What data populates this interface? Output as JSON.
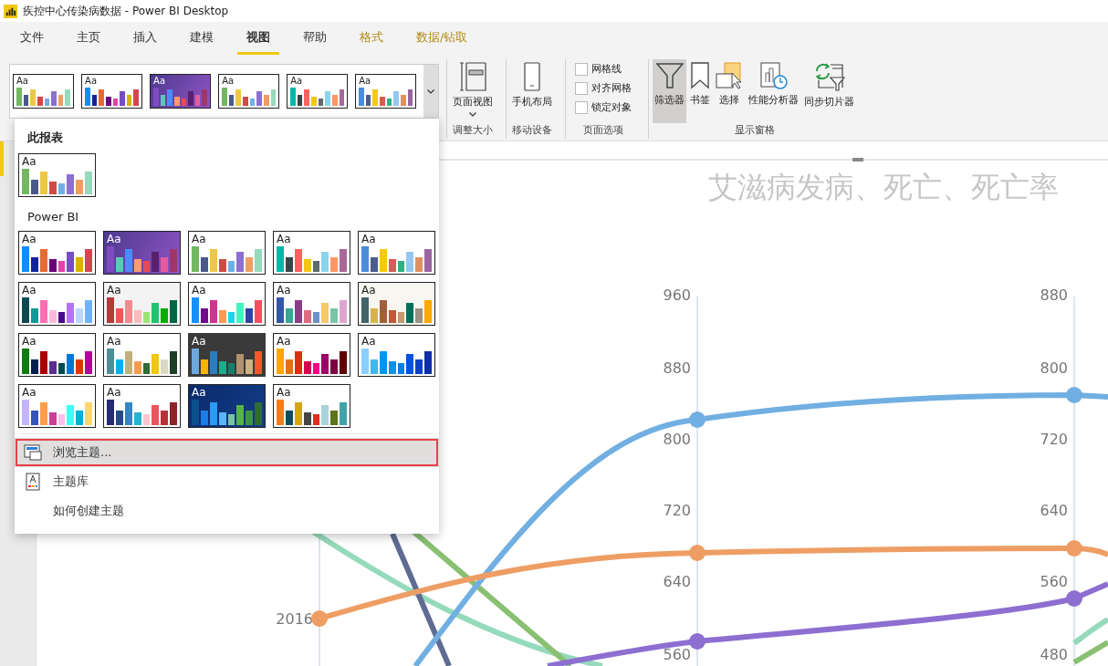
{
  "window": {
    "title": "疾控中心传染病数据 - Power BI Desktop"
  },
  "tabs": [
    {
      "label": "文件",
      "kind": "normal",
      "selected": false
    },
    {
      "label": "主页",
      "kind": "normal",
      "selected": false
    },
    {
      "label": "插入",
      "kind": "normal",
      "selected": false
    },
    {
      "label": "建模",
      "kind": "normal",
      "selected": false
    },
    {
      "label": "视图",
      "kind": "normal",
      "selected": true
    },
    {
      "label": "帮助",
      "kind": "normal",
      "selected": false
    },
    {
      "label": "格式",
      "kind": "contextual",
      "selected": false
    },
    {
      "label": "数据/钻取",
      "kind": "contextual",
      "selected": false
    }
  ],
  "ribbon": {
    "theme_gallery": [
      {
        "sample": "Aa",
        "kind": "light",
        "bars": [
          {
            "color": "#73b761"
          },
          {
            "color": "#4a588a"
          },
          {
            "color": "#ecc846"
          },
          {
            "color": "#cd4c46"
          },
          {
            "color": "#71afe2"
          },
          {
            "color": "#8d6fd1"
          },
          {
            "color": "#ee9e64"
          },
          {
            "color": "#95dabb"
          }
        ]
      },
      {
        "sample": "Aa",
        "kind": "light",
        "bars": [
          {
            "color": "#118dff"
          },
          {
            "color": "#12239e"
          },
          {
            "color": "#e66c37"
          },
          {
            "color": "#6b007b"
          },
          {
            "color": "#e044a7"
          },
          {
            "color": "#744ec2"
          },
          {
            "color": "#d9b300"
          },
          {
            "color": "#d64550"
          }
        ]
      },
      {
        "sample": "Aa",
        "kind": "purple",
        "bars": [
          {
            "color": "#7f4bc0"
          },
          {
            "color": "#5bc9b4"
          },
          {
            "color": "#4a8cff"
          },
          {
            "color": "#ff9a70"
          },
          {
            "color": "#e84a55"
          },
          {
            "color": "#5a2070"
          },
          {
            "color": "#e85a9c"
          },
          {
            "color": "#a0356a"
          }
        ]
      },
      {
        "sample": "Aa",
        "kind": "light",
        "bars": [
          {
            "color": "#73b761"
          },
          {
            "color": "#4a588a"
          },
          {
            "color": "#ecc846"
          },
          {
            "color": "#cd4c46"
          },
          {
            "color": "#71afe2"
          },
          {
            "color": "#8d6fd1"
          },
          {
            "color": "#ee9e64"
          },
          {
            "color": "#95dabb"
          }
        ]
      },
      {
        "sample": "Aa",
        "kind": "light",
        "bars": [
          {
            "color": "#01b8aa"
          },
          {
            "color": "#374649"
          },
          {
            "color": "#fd625e"
          },
          {
            "color": "#f2c80f"
          },
          {
            "color": "#5f6b6d"
          },
          {
            "color": "#8ad4eb"
          },
          {
            "color": "#fe9666"
          },
          {
            "color": "#a66999"
          }
        ]
      },
      {
        "sample": "Aa",
        "kind": "light",
        "bars": [
          {
            "color": "#4a8ddc"
          },
          {
            "color": "#4c5d8a"
          },
          {
            "color": "#f3c911"
          },
          {
            "color": "#dc5b57"
          },
          {
            "color": "#33ae81"
          },
          {
            "color": "#95c8f0"
          },
          {
            "color": "#dd915f"
          },
          {
            "color": "#9a64a0"
          }
        ]
      }
    ],
    "groups": [
      {
        "label": "调整大小",
        "kind": "buttons",
        "items": [
          {
            "label": "页面视图",
            "kind": "page-view",
            "caret": true,
            "selected": false
          }
        ]
      },
      {
        "label": "移动设备",
        "kind": "buttons",
        "items": [
          {
            "label": "手机布局",
            "kind": "phone",
            "caret": false,
            "selected": false
          }
        ]
      },
      {
        "label": "页面选项",
        "kind": "checkboxes",
        "items": [
          {
            "label": "网格线",
            "checked": false
          },
          {
            "label": "对齐网格",
            "checked": false
          },
          {
            "label": "锁定对象",
            "checked": false
          }
        ]
      },
      {
        "label": "显示窗格",
        "kind": "buttons",
        "items": [
          {
            "label": "筛选器",
            "kind": "filter",
            "caret": false,
            "selected": true
          },
          {
            "label": "书签",
            "kind": "bookmark",
            "caret": false,
            "selected": false
          },
          {
            "label": "选择",
            "kind": "selection",
            "caret": false,
            "selected": false
          },
          {
            "label": "性能分析器",
            "kind": "performance",
            "caret": false,
            "selected": false
          },
          {
            "label": "同步切片器",
            "kind": "sync",
            "caret": false,
            "selected": false
          }
        ]
      }
    ]
  },
  "theme_menu": {
    "sections": [
      {
        "heading": "此报表",
        "themes": [
          {
            "sample": "Aa",
            "kind": "light",
            "bars": [
              {
                "color": "#73b761"
              },
              {
                "color": "#4a588a"
              },
              {
                "color": "#ecc846"
              },
              {
                "color": "#cd4c46"
              },
              {
                "color": "#71afe2"
              },
              {
                "color": "#8d6fd1"
              },
              {
                "color": "#ee9e64"
              },
              {
                "color": "#95dabb"
              }
            ]
          }
        ]
      },
      {
        "heading": "Power BI",
        "themes": [
          {
            "sample": "Aa",
            "kind": "light",
            "bars": [
              {
                "color": "#118dff"
              },
              {
                "color": "#12239e"
              },
              {
                "color": "#e66c37"
              },
              {
                "color": "#6b007b"
              },
              {
                "color": "#e044a7"
              },
              {
                "color": "#744ec2"
              },
              {
                "color": "#d9b300"
              },
              {
                "color": "#d64550"
              }
            ]
          },
          {
            "sample": "Aa",
            "kind": "purple",
            "bars": [
              {
                "color": "#7f4bc0"
              },
              {
                "color": "#5bc9b4"
              },
              {
                "color": "#4a8cff"
              },
              {
                "color": "#ff9a70"
              },
              {
                "color": "#e84a55"
              },
              {
                "color": "#5a2070"
              },
              {
                "color": "#e85a9c"
              },
              {
                "color": "#a0356a"
              }
            ]
          },
          {
            "sample": "Aa",
            "kind": "light",
            "bars": [
              {
                "color": "#73b761"
              },
              {
                "color": "#4a588a"
              },
              {
                "color": "#ecc846"
              },
              {
                "color": "#cd4c46"
              },
              {
                "color": "#71afe2"
              },
              {
                "color": "#8d6fd1"
              },
              {
                "color": "#ee9e64"
              },
              {
                "color": "#95dabb"
              }
            ]
          },
          {
            "sample": "Aa",
            "kind": "light",
            "bars": [
              {
                "color": "#01b8aa"
              },
              {
                "color": "#374649"
              },
              {
                "color": "#fd625e"
              },
              {
                "color": "#f2c80f"
              },
              {
                "color": "#5f6b6d"
              },
              {
                "color": "#8ad4eb"
              },
              {
                "color": "#fe9666"
              },
              {
                "color": "#a66999"
              }
            ]
          },
          {
            "sample": "Aa",
            "kind": "light",
            "bars": [
              {
                "color": "#4a8ddc"
              },
              {
                "color": "#4c5d8a"
              },
              {
                "color": "#f3c911"
              },
              {
                "color": "#dc5b57"
              },
              {
                "color": "#33ae81"
              },
              {
                "color": "#95c8f0"
              },
              {
                "color": "#dd915f"
              },
              {
                "color": "#9a64a0"
              }
            ]
          },
          {
            "sample": "Aa",
            "kind": "light",
            "bars": [
              {
                "color": "#0b4a52"
              },
              {
                "color": "#119a9a"
              },
              {
                "color": "#ff6fb4"
              },
              {
                "color": "#ffb8dc"
              },
              {
                "color": "#4b0a8e"
              },
              {
                "color": "#b672ff"
              },
              {
                "color": "#b8d8ff"
              },
              {
                "color": "#6fb2ff"
              }
            ]
          },
          {
            "sample": "Aa",
            "kind": "gray",
            "bars": [
              {
                "color": "#b73a3a"
              },
              {
                "color": "#ec5656"
              },
              {
                "color": "#f28a90"
              },
              {
                "color": "#f8bcbd"
              },
              {
                "color": "#99e472"
              },
              {
                "color": "#23c26f"
              },
              {
                "color": "#0aac00"
              },
              {
                "color": "#026645"
              }
            ]
          },
          {
            "sample": "Aa",
            "kind": "light",
            "bars": [
              {
                "color": "#1690ff"
              },
              {
                "color": "#700e8a"
              },
              {
                "color": "#d0348f"
              },
              {
                "color": "#ff9955"
              },
              {
                "color": "#1ed3ec"
              },
              {
                "color": "#44f4c0"
              },
              {
                "color": "#3142a8"
              },
              {
                "color": "#f4505f"
              }
            ]
          },
          {
            "sample": "Aa",
            "kind": "light",
            "bars": [
              {
                "color": "#3257a8"
              },
              {
                "color": "#37a794"
              },
              {
                "color": "#8b3d88"
              },
              {
                "color": "#dd6b7f"
              },
              {
                "color": "#6b91c9"
              },
              {
                "color": "#f5c869"
              },
              {
                "color": "#77c4a8"
              },
              {
                "color": "#dea6cf"
              }
            ]
          },
          {
            "sample": "Aa",
            "kind": "cream",
            "bars": [
              {
                "color": "#426367"
              },
              {
                "color": "#d5b44d"
              },
              {
                "color": "#a1603c"
              },
              {
                "color": "#c2573c"
              },
              {
                "color": "#c49a6c"
              },
              {
                "color": "#00705a"
              },
              {
                "color": "#9b9185"
              },
              {
                "color": "#fda900"
              }
            ]
          },
          {
            "sample": "Aa",
            "kind": "light",
            "bars": [
              {
                "color": "#107c10"
              },
              {
                "color": "#002050"
              },
              {
                "color": "#a80000"
              },
              {
                "color": "#5c2d91"
              },
              {
                "color": "#004b50"
              },
              {
                "color": "#0078d7"
              },
              {
                "color": "#d83b01"
              },
              {
                "color": "#b4009e"
              }
            ]
          },
          {
            "sample": "Aa",
            "kind": "light",
            "bars": [
              {
                "color": "#4e8e96"
              },
              {
                "color": "#00b0f0"
              },
              {
                "color": "#c4b07b"
              },
              {
                "color": "#f59c4c"
              },
              {
                "color": "#2f6b37"
              },
              {
                "color": "#efc615"
              },
              {
                "color": "#d9d9c2"
              },
              {
                "color": "#1e3f26"
              }
            ]
          },
          {
            "sample": "Aa",
            "kind": "dark",
            "bars": [
              {
                "color": "#6fa8dc"
              },
              {
                "color": "#f5b400"
              },
              {
                "color": "#2d7cc0"
              },
              {
                "color": "#1aac8b"
              },
              {
                "color": "#12806b"
              },
              {
                "color": "#b0926e"
              },
              {
                "color": "#c9b27e"
              },
              {
                "color": "#f15a29"
              }
            ]
          },
          {
            "sample": "Aa",
            "kind": "light",
            "bars": [
              {
                "color": "#ffa600"
              },
              {
                "color": "#e8700a"
              },
              {
                "color": "#de2e0f"
              },
              {
                "color": "#d6004f"
              },
              {
                "color": "#f20088"
              },
              {
                "color": "#9b0068"
              },
              {
                "color": "#7b0040"
              },
              {
                "color": "#5c0000"
              }
            ]
          },
          {
            "sample": "Aa",
            "kind": "light",
            "bars": [
              {
                "color": "#8ad0ff"
              },
              {
                "color": "#3fb8f2"
              },
              {
                "color": "#0096f0"
              },
              {
                "color": "#1190ea"
              },
              {
                "color": "#0a7cea"
              },
              {
                "color": "#0052e0"
              },
              {
                "color": "#0c3fc4"
              },
              {
                "color": "#0d2ea6"
              }
            ]
          },
          {
            "sample": "Aa",
            "kind": "light",
            "bars": [
              {
                "color": "#c4b3ff"
              },
              {
                "color": "#3654b9"
              },
              {
                "color": "#ff9d4d"
              },
              {
                "color": "#cc3e98"
              },
              {
                "color": "#ffbcec"
              },
              {
                "color": "#40fff4"
              },
              {
                "color": "#00b1d4"
              },
              {
                "color": "#ffd66e"
              }
            ]
          },
          {
            "sample": "Aa",
            "kind": "light",
            "bars": [
              {
                "color": "#282a73"
              },
              {
                "color": "#234a8c"
              },
              {
                "color": "#3286c3"
              },
              {
                "color": "#27b3d0"
              },
              {
                "color": "#ffc5cc"
              },
              {
                "color": "#e95660"
              },
              {
                "color": "#b63237"
              },
              {
                "color": "#8c2428"
              }
            ]
          },
          {
            "sample": "Aa",
            "kind": "navy",
            "bars": [
              {
                "color": "#0c4e8e"
              },
              {
                "color": "#1b7de8"
              },
              {
                "color": "#2a9bf5"
              },
              {
                "color": "#5ab6f5"
              },
              {
                "color": "#78c4a0"
              },
              {
                "color": "#55b348"
              },
              {
                "color": "#3e9445"
              },
              {
                "color": "#2e6b35"
              }
            ]
          },
          {
            "sample": "Aa",
            "kind": "light",
            "bars": [
              {
                "color": "#f47d21"
              },
              {
                "color": "#0b4f5e"
              },
              {
                "color": "#d4a617"
              },
              {
                "color": "#464646"
              },
              {
                "color": "#de2f23"
              },
              {
                "color": "#a8d3d8"
              },
              {
                "color": "#5c751a"
              },
              {
                "color": "#43a4a8"
              }
            ]
          }
        ]
      }
    ],
    "items": [
      {
        "label": "浏览主题...",
        "kind": "browse",
        "selected": true
      },
      {
        "label": "主题库",
        "kind": "library",
        "selected": false
      },
      {
        "label": "如何创建主题",
        "kind": "plain",
        "selected": false
      }
    ]
  },
  "report": {
    "chart_title": "艾滋病发病、死亡、死亡率",
    "axes": [
      {
        "ticks": [
          "960",
          "880",
          "800",
          "720",
          "640",
          "560"
        ]
      },
      {
        "ticks": [
          "880",
          "800",
          "720",
          "640",
          "560",
          "480"
        ]
      }
    ],
    "year_label": "2016"
  }
}
